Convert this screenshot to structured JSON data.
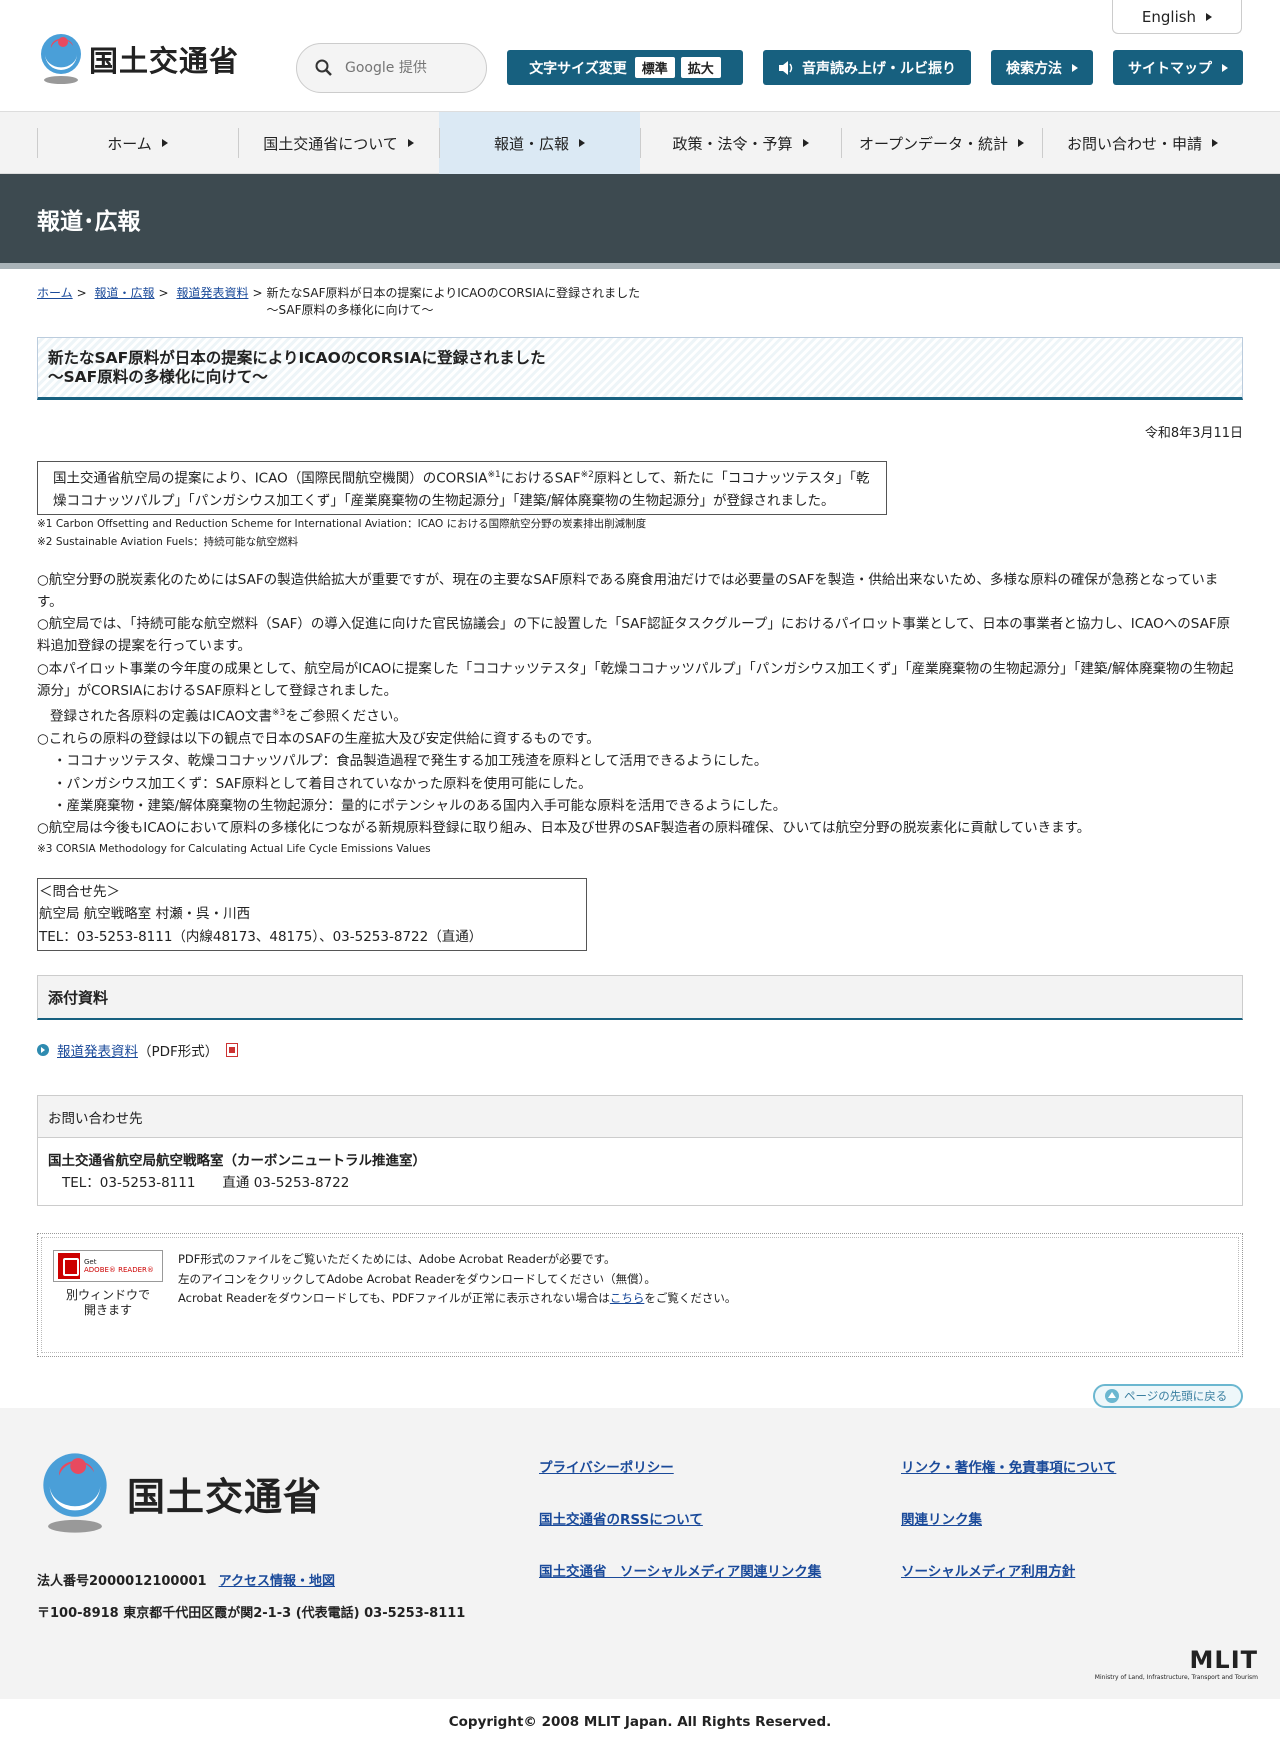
{
  "header": {
    "logo_text": "国土交通省",
    "lang_label": "English",
    "search_placeholder": "Google 提供",
    "font_size_label": "文字サイズ変更",
    "font_standard": "標準",
    "font_large": "拡大",
    "speech_label": "音声読み上げ・ルビ振り",
    "search_method_label": "検索方法",
    "sitemap_label": "サイトマップ"
  },
  "nav": {
    "items": [
      {
        "label": "ホーム"
      },
      {
        "label": "国土交通省について"
      },
      {
        "label": "報道・広報"
      },
      {
        "label": "政策・法令・予算"
      },
      {
        "label": "オープンデータ・統計"
      },
      {
        "label": "お問い合わせ・申請"
      }
    ]
  },
  "banner": {
    "title": "報道･広報"
  },
  "breadcrumb": {
    "home": "ホーム",
    "press": "報道・広報",
    "releases": "報道発表資料",
    "sep": ">",
    "current_line1": "新たなSAF原料が日本の提案によりICAOのCORSIAに登録されました",
    "current_line2": "～SAF原料の多様化に向けて～"
  },
  "article": {
    "title_line1": "新たなSAF原料が日本の提案によりICAOのCORSIAに登録されました",
    "title_line2": "～SAF原料の多様化に向けて～",
    "date": "令和8年3月11日",
    "summary_a": "国土交通省航空局の提案により、ICAO（国際民間航空機関）のCORSIA",
    "summary_sup1": "※1",
    "summary_b": "におけるSAF",
    "summary_sup2": "※2",
    "summary_c": "原料として、新たに「ココナッツテスタ」「乾燥ココナッツパルプ」「パンガシウス加工くず」「産業廃棄物の生物起源分」「建築/解体廃棄物の生物起源分」が登録されました。",
    "note1": "※1 Carbon Offsetting and Reduction Scheme for International Aviation：ICAO における国際航空分野の炭素排出削減制度",
    "note2": "※2 Sustainable Aviation Fuels：持続可能な航空燃料",
    "para1": "○航空分野の脱炭素化のためにはSAFの製造供給拡大が重要ですが、現在の主要なSAF原料である廃食用油だけでは必要量のSAFを製造・供給出来ないため、多様な原料の確保が急務となっています。",
    "para2": "○航空局では、「持続可能な航空燃料（SAF）の導入促進に向けた官民協議会」の下に設置した「SAF認証タスクグループ」におけるパイロット事業として、日本の事業者と協力し、ICAOへのSAF原料追加登録の提案を行っています。",
    "para3": "○本パイロット事業の今年度の成果として、航空局がICAOに提案した「ココナッツテスタ」「乾燥ココナッツパルプ」「パンガシウス加工くず」「産業廃棄物の生物起源分」「建築/解体廃棄物の生物起源分」がCORSIAにおけるSAF原料として登録されました。",
    "para4a": "登録された各原料の定義はICAO文書",
    "para4sup": "※3",
    "para4b": "をご参照ください。",
    "para5": "○これらの原料の登録は以下の観点で日本のSAFの生産拡大及び安定供給に資するものです。",
    "bullet1": "・ココナッツテスタ、乾燥ココナッツパルプ：食品製造過程で発生する加工残渣を原料として活用できるようにした。",
    "bullet2": "・パンガシウス加工くず：SAF原料として着目されていなかった原料を使用可能にした。",
    "bullet3": "・産業廃棄物・建築/解体廃棄物の生物起源分：量的にポテンシャルのある国内入手可能な原料を活用できるようにした。",
    "para6": "○航空局は今後もICAOにおいて原料の多様化につながる新規原料登録に取り組み、日本及び世界のSAF製造者の原料確保、ひいては航空分野の脱炭素化に貢献していきます。",
    "note3": "※3 CORSIA Methodology for Calculating Actual Life Cycle Emissions Values",
    "contact_head": "＜問合せ先＞",
    "contact_dept": "航空局 航空戦略室 村瀬・呉・川西",
    "contact_tel": "TEL：03-5253-8111（内線48173、48175）、03-5253-8722（直通）"
  },
  "attachments": {
    "heading": "添付資料",
    "link_label": "報道発表資料",
    "format": "（PDF形式）"
  },
  "inquiry": {
    "heading": "お問い合わせ先",
    "org": "国土交通省航空局航空戦略室（カーボンニュートラル推進室）",
    "tel": "TEL：03-5253-8111　　直通 03-5253-8722"
  },
  "reader": {
    "badge_get": "Get",
    "badge_name": "ADOBE® READER®",
    "caption_line1": "別ウィンドウで",
    "caption_line2": "開きます",
    "line1": "PDF形式のファイルをご覧いただくためには、Adobe Acrobat Readerが必要です。",
    "line2": "左のアイコンをクリックしてAdobe Acrobat Readerをダウンロードしてください（無償）。",
    "line3a": "Acrobat Readerをダウンロードしても、PDFファイルが正常に表示されない場合は",
    "line3link": "こちら",
    "line3b": "をご覧ください。"
  },
  "to_top": "ページの先頭に戻る",
  "footer": {
    "logo_text": "国土交通省",
    "corp_number": "法人番号2000012100001",
    "access": "アクセス情報・地図",
    "address": "〒100-8918 東京都千代田区霞が関2-1-3 (代表電話) 03-5253-8111",
    "links": [
      {
        "label": "プライバシーポリシー"
      },
      {
        "label": "リンク・著作権・免責事項について"
      },
      {
        "label": "国土交通省のRSSについて"
      },
      {
        "label": "関連リンク集"
      },
      {
        "label": "国土交通省　ソーシャルメディア関連リンク集"
      },
      {
        "label": "ソーシャルメディア利用方針"
      }
    ],
    "mlit": "MLIT",
    "mlit_sub": "Ministry of Land, Infrastructure, Transport and Tourism",
    "copyright": "Copyright© 2008 MLIT Japan. All Rights Reserved."
  },
  "colors": {
    "accent": "#17607f",
    "banner": "#3d4a50",
    "link": "#1a4a9a"
  }
}
